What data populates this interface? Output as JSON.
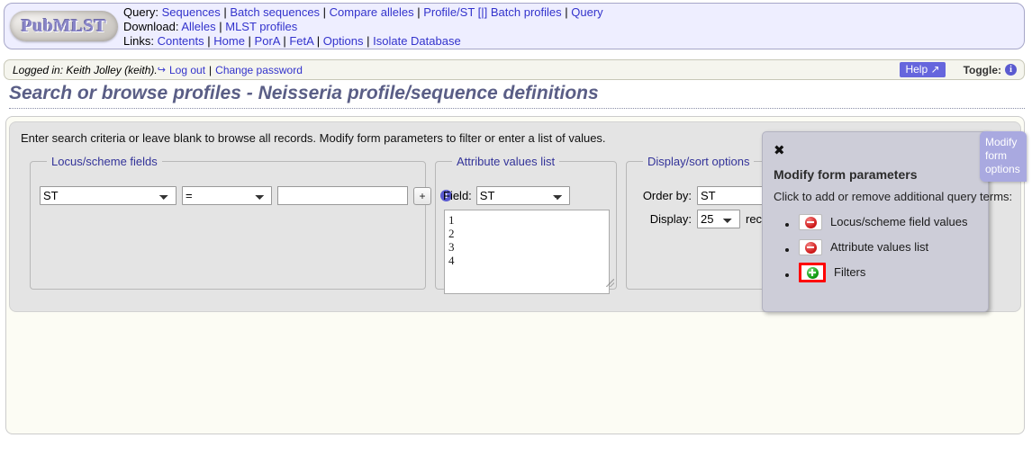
{
  "banner": {
    "logo_text": "PubMLST",
    "rows": [
      {
        "label": "Query:",
        "links": [
          "Sequences",
          "Batch sequences",
          "Compare alleles",
          "Profile/ST [|]",
          "Batch profiles",
          "Query"
        ]
      },
      {
        "label": "Download:",
        "links": [
          "Alleles",
          "MLST profiles"
        ]
      },
      {
        "label": "Links:",
        "links": [
          "Contents",
          "Home",
          "PorA",
          "FetA",
          "Options",
          "Isolate Database"
        ]
      }
    ]
  },
  "login_bar": {
    "logged_in_text": "Logged in: Keith Jolley (keith).",
    "logout_label": "Log out",
    "separator": "|",
    "change_password_label": "Change password",
    "help_label": "Help",
    "help_icon": "external-link-icon",
    "toggle_label": "Toggle:",
    "toggle_icon": "info-icon"
  },
  "page_title": "Search or browse profiles - Neisseria profile/sequence definitions",
  "form": {
    "intro": "Enter search criteria or leave blank to browse all records. Modify form parameters to filter or enter a list of values.",
    "locus_fieldset": {
      "legend": "Locus/scheme fields",
      "field_value": "ST",
      "field_options": [
        "ST"
      ],
      "operator_value": "=",
      "operator_options": [
        "="
      ],
      "text_value": "",
      "text_placeholder": "",
      "add_label": "+",
      "info_icon": "info-icon"
    },
    "attribute_fieldset": {
      "legend": "Attribute values list",
      "field_label": "Field:",
      "field_value": "ST",
      "field_options": [
        "ST"
      ],
      "list_value": "1\n2\n3\n4"
    },
    "display_fieldset": {
      "legend": "Display/sort options",
      "order_by_label": "Order by:",
      "order_by_value": "ST",
      "order_by_options": [
        "ST"
      ],
      "display_label": "Display:",
      "display_value": "25",
      "display_options": [
        "25"
      ],
      "records_label": "records"
    }
  },
  "modify_popup": {
    "close_icon": "close-icon",
    "heading": "Modify form parameters",
    "subtext": "Click to add or remove additional query terms:",
    "items": [
      {
        "label": "Locus/scheme field values",
        "icon": "minus-circle-icon",
        "state": "remove",
        "highlighted": false
      },
      {
        "label": "Attribute values list",
        "icon": "minus-circle-icon",
        "state": "remove",
        "highlighted": false
      },
      {
        "label": "Filters",
        "icon": "plus-circle-icon",
        "state": "add",
        "highlighted": true
      }
    ]
  },
  "modify_tab": {
    "label": "Modify form options"
  },
  "colors": {
    "banner_bg": "#eeeeff",
    "link": "#3333cc",
    "title": "#5a5e86",
    "legend": "#333399",
    "panel_bg": "#e4e4e4",
    "popup_bg": "#cdcdd8",
    "tab_bg": "#a9a9e0",
    "help_bg": "#6666dd",
    "highlight_border": "#ff0000",
    "minus_icon": "#d01b1b",
    "plus_icon": "#129b12"
  }
}
